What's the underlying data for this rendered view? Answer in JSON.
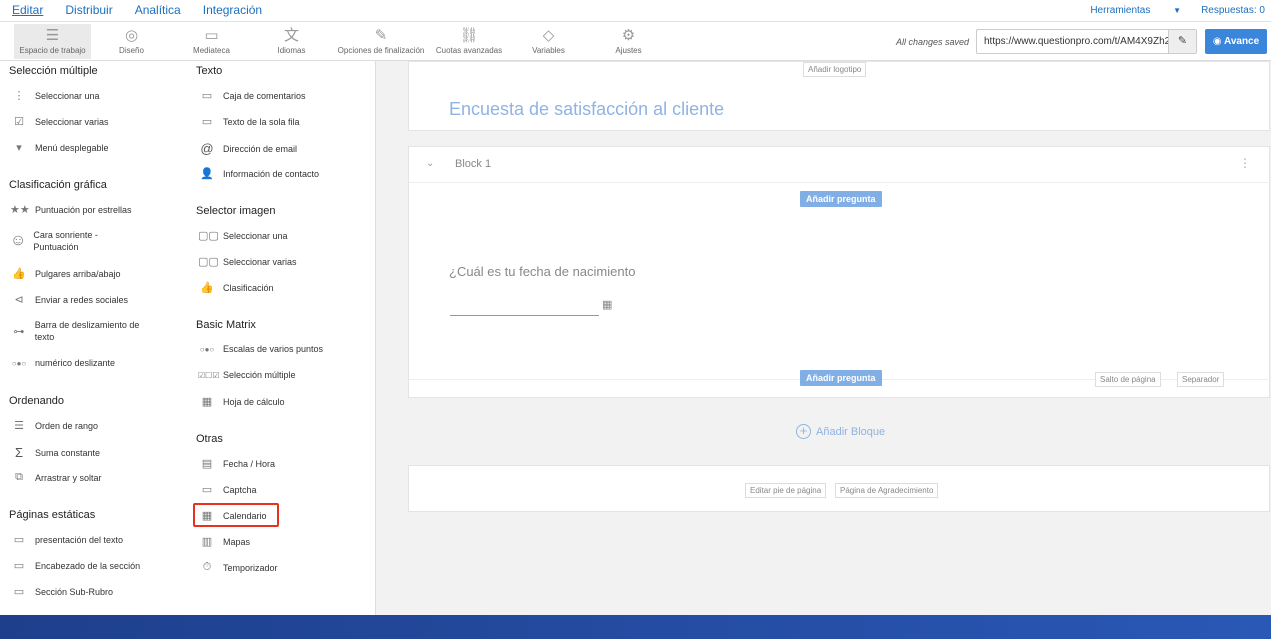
{
  "nav": {
    "items": [
      "Editar",
      "Distribuir",
      "Analítica",
      "Integración"
    ],
    "herramientas": "Herramientas",
    "respuestas": "Respuestas: 0"
  },
  "toolbar": {
    "tools": [
      {
        "label": "Espacio de trabajo",
        "icon": "workspace-icon"
      },
      {
        "label": "Diseño",
        "icon": "palette-icon"
      },
      {
        "label": "Mediateca",
        "icon": "image-icon"
      },
      {
        "label": "Idiomas",
        "icon": "language-icon"
      },
      {
        "label": "Opciones de finalización",
        "icon": "magic-wand-icon"
      },
      {
        "label": "Cuotas avanzadas",
        "icon": "link-icon"
      },
      {
        "label": "Variables",
        "icon": "tag-icon"
      },
      {
        "label": "Ajustes",
        "icon": "gear-icon"
      }
    ],
    "saved": "All changes saved",
    "url": "https://www.questionpro.com/t/AM4X9Zh2",
    "avance": "Avance"
  },
  "sidebar": {
    "seleccion_multiple": {
      "title": "Selección múltiple",
      "items": [
        "Seleccionar una",
        "Seleccionar varias",
        "Menú desplegable"
      ]
    },
    "clasificacion_grafica": {
      "title": "Clasificación gráfica",
      "items": [
        "Puntuación por estrellas",
        "Cara sonriente - Puntuación",
        "Pulgares arriba/abajo",
        "Enviar a redes sociales",
        "Barra de deslizamiento de texto",
        "numérico deslizante"
      ]
    },
    "ordenando": {
      "title": "Ordenando",
      "items": [
        "Orden de rango",
        "Suma constante",
        "Arrastrar y soltar"
      ]
    },
    "paginas_estaticas": {
      "title": "Páginas estáticas",
      "items": [
        "presentación del texto",
        "Encabezado de la sección",
        "Sección Sub-Rubro"
      ]
    },
    "texto": {
      "title": "Texto",
      "items": [
        "Caja de comentarios",
        "Texto de la sola fila",
        "Dirección de email",
        "Información de contacto"
      ]
    },
    "selector_imagen": {
      "title": "Selector imagen",
      "items": [
        "Seleccionar una",
        "Seleccionar varias",
        "Clasificación"
      ]
    },
    "basic_matrix": {
      "title": "Basic Matrix",
      "items": [
        "Escalas de varios puntos",
        "Selección múltiple",
        "Hoja de cálculo"
      ]
    },
    "otras": {
      "title": "Otras",
      "items": [
        "Fecha / Hora",
        "Captcha",
        "Calendario",
        "Mapas",
        "Temporizador"
      ]
    }
  },
  "canvas": {
    "add_logo": "Añadir logotipo",
    "survey_title": "Encuesta de satisfacción al cliente",
    "block_name": "Block 1",
    "add_question": "Añadir pregunta",
    "question": "¿Cuál es tu fecha de nacimiento",
    "page_break": "Salto de página",
    "separator": "Separador",
    "add_block": "Añadir Bloque",
    "edit_footer": "Editar pie de página",
    "thanks_page": "Página de Agradecimiento"
  }
}
